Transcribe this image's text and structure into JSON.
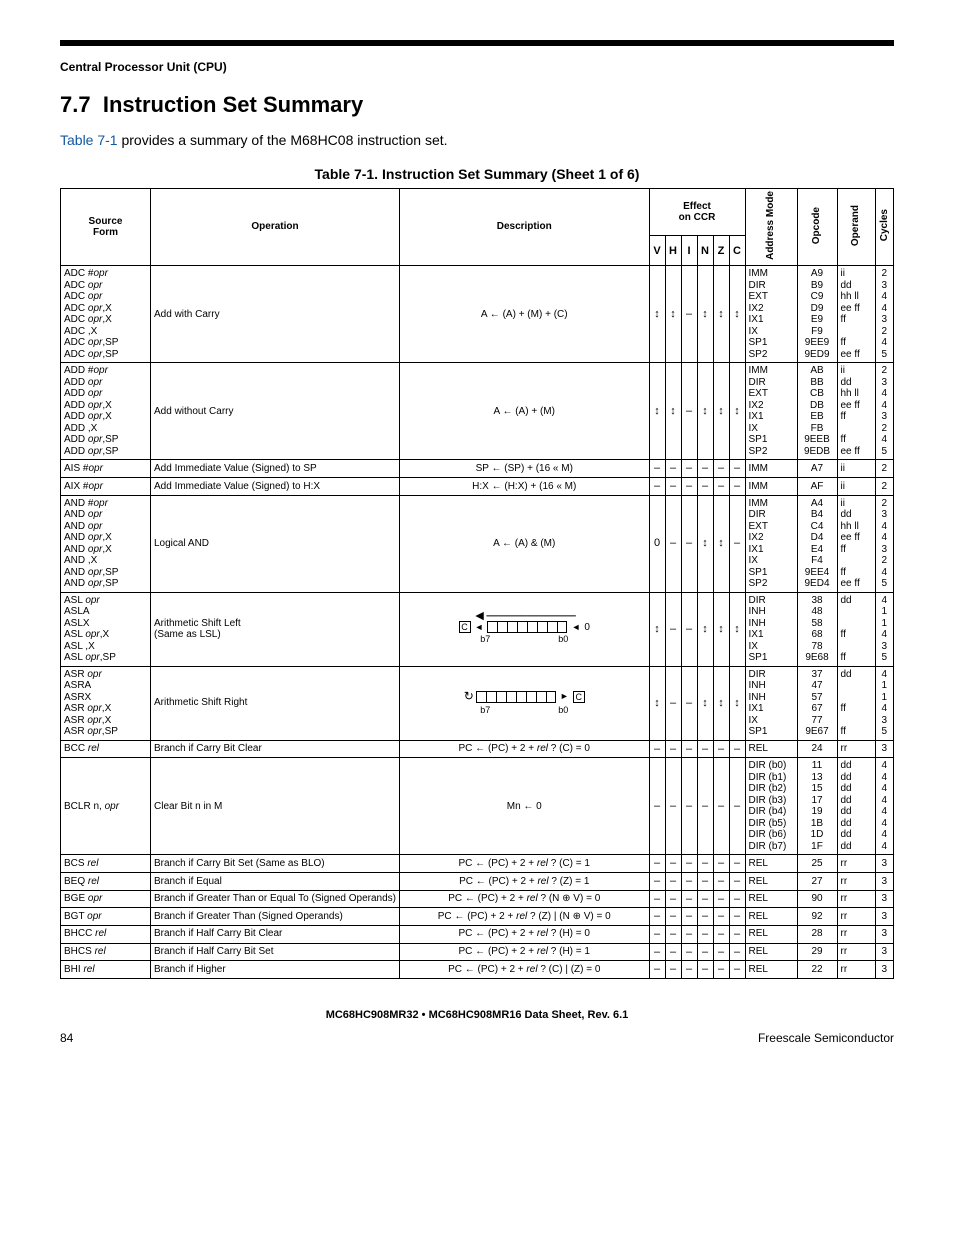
{
  "running_head": "Central Processor Unit (CPU)",
  "section_number": "7.7",
  "section_title": "Instruction Set Summary",
  "intro_link": "Table 7-1",
  "intro_rest": " provides a summary of the M68HC08 instruction set.",
  "table_caption": "Table 7-1. Instruction Set Summary (Sheet 1 of 6)",
  "headers": {
    "source_form": "Source\nForm",
    "operation": "Operation",
    "description": "Description",
    "effect": "Effect\non CCR",
    "addr_mode": "Address\nMode",
    "opcode": "Opcode",
    "operand": "Operand",
    "cycles": "Cycles",
    "ccr_cols": [
      "V",
      "H",
      "I",
      "N",
      "Z",
      "C"
    ]
  },
  "rows": [
    {
      "source": "ADC #opr\nADC opr\nADC opr\nADC opr,X\nADC opr,X\nADC ,X\nADC opr,SP\nADC opr,SP",
      "operation": "Add with Carry",
      "description": "A ← (A) + (M) + (C)",
      "ccr": [
        "↕",
        "↕",
        "–",
        "↕",
        "↕",
        "↕"
      ],
      "addr": "IMM\nDIR\nEXT\nIX2\nIX1\nIX\nSP1\nSP2",
      "opcode": "A9\nB9\nC9\nD9\nE9\nF9\n9EE9\n9ED9",
      "operand": "ii\ndd\nhh ll\nee ff\nff\n\nff\nee ff",
      "cycles": "2\n3\n4\n4\n3\n2\n4\n5"
    },
    {
      "source": "ADD #opr\nADD opr\nADD opr\nADD opr,X\nADD opr,X\nADD ,X\nADD opr,SP\nADD opr,SP",
      "operation": "Add without Carry",
      "description": "A ← (A) + (M)",
      "ccr": [
        "↕",
        "↕",
        "–",
        "↕",
        "↕",
        "↕"
      ],
      "addr": "IMM\nDIR\nEXT\nIX2\nIX1\nIX\nSP1\nSP2",
      "opcode": "AB\nBB\nCB\nDB\nEB\nFB\n9EEB\n9EDB",
      "operand": "ii\ndd\nhh ll\nee ff\nff\n\nff\nee ff",
      "cycles": "2\n3\n4\n4\n3\n2\n4\n5"
    },
    {
      "source": "AIS #opr",
      "source_italic_last": true,
      "operation": "Add Immediate Value (Signed) to SP",
      "description": "SP ← (SP) + (16 « M)",
      "ccr": [
        "–",
        "–",
        "–",
        "–",
        "–",
        "–"
      ],
      "addr": "IMM",
      "opcode": "A7",
      "operand": "ii",
      "cycles": "2"
    },
    {
      "source": "AIX #opr",
      "operation": "Add Immediate Value (Signed) to H:X",
      "description": "H:X ← (H:X) + (16 « M)",
      "ccr": [
        "–",
        "–",
        "–",
        "–",
        "–",
        "–"
      ],
      "addr": "IMM",
      "opcode": "AF",
      "operand": "ii",
      "cycles": "2"
    },
    {
      "source": "AND #opr\nAND opr\nAND opr\nAND opr,X\nAND opr,X\nAND ,X\nAND opr,SP\nAND opr,SP",
      "operation": "Logical AND",
      "description": "A ← (A) & (M)",
      "ccr": [
        "0",
        "–",
        "–",
        "↕",
        "↕",
        "–"
      ],
      "addr": "IMM\nDIR\nEXT\nIX2\nIX1\nIX\nSP1\nSP2",
      "opcode": "A4\nB4\nC4\nD4\nE4\nF4\n9EE4\n9ED4",
      "operand": "ii\ndd\nhh ll\nee ff\nff\n\nff\nee ff",
      "cycles": "2\n3\n4\n4\n3\n2\n4\n5"
    },
    {
      "source": "ASL opr\nASLA\nASLX\nASL opr,X\nASL ,X\nASL opr,SP",
      "operation": "Arithmetic Shift Left\n(Same as LSL)",
      "description_diagram": "asl",
      "ccr": [
        "↕",
        "–",
        "–",
        "↕",
        "↕",
        "↕"
      ],
      "addr": "DIR\nINH\nINH\nIX1\nIX\nSP1",
      "opcode": "38\n48\n58\n68\n78\n9E68",
      "operand": "dd\n\n\nff\n\nff",
      "cycles": "4\n1\n1\n4\n3\n5"
    },
    {
      "source": "ASR opr\nASRA\nASRX\nASR opr,X\nASR opr,X\nASR opr,SP",
      "operation": "Arithmetic Shift Right",
      "description_diagram": "asr",
      "ccr": [
        "↕",
        "–",
        "–",
        "↕",
        "↕",
        "↕"
      ],
      "addr": "DIR\nINH\nINH\nIX1\nIX\nSP1",
      "opcode": "37\n47\n57\n67\n77\n9E67",
      "operand": "dd\n\n\nff\n\nff",
      "cycles": "4\n1\n1\n4\n3\n5"
    },
    {
      "source": "BCC rel",
      "operation": "Branch if Carry Bit Clear",
      "description": "PC ← (PC) + 2 + rel ? (C) = 0",
      "ccr": [
        "–",
        "–",
        "–",
        "–",
        "–",
        "–"
      ],
      "addr": "REL",
      "opcode": "24",
      "operand": "rr",
      "cycles": "3"
    },
    {
      "source": "BCLR n, opr",
      "operation": "Clear Bit n in M",
      "description": "Mn ← 0",
      "ccr": [
        "–",
        "–",
        "–",
        "–",
        "–",
        "–"
      ],
      "addr": "DIR (b0)\nDIR (b1)\nDIR (b2)\nDIR (b3)\nDIR (b4)\nDIR (b5)\nDIR (b6)\nDIR (b7)",
      "opcode": "11\n13\n15\n17\n19\n1B\n1D\n1F",
      "operand": "dd\ndd\ndd\ndd\ndd\ndd\ndd\ndd",
      "cycles": "4\n4\n4\n4\n4\n4\n4\n4"
    },
    {
      "source": "BCS rel",
      "operation": "Branch if Carry Bit Set (Same as BLO)",
      "description": "PC ← (PC) + 2 + rel ? (C) = 1",
      "ccr": [
        "–",
        "–",
        "–",
        "–",
        "–",
        "–"
      ],
      "addr": "REL",
      "opcode": "25",
      "operand": "rr",
      "cycles": "3"
    },
    {
      "source": "BEQ rel",
      "operation": "Branch if Equal",
      "description": "PC ← (PC) + 2 + rel ? (Z) = 1",
      "ccr": [
        "–",
        "–",
        "–",
        "–",
        "–",
        "–"
      ],
      "addr": "REL",
      "opcode": "27",
      "operand": "rr",
      "cycles": "3"
    },
    {
      "source": "BGE opr",
      "operation": "Branch if Greater Than or Equal To (Signed Operands)",
      "description": "PC ← (PC) + 2 + rel ? (N ⊕ V) = 0",
      "ccr": [
        "–",
        "–",
        "–",
        "–",
        "–",
        "–"
      ],
      "addr": "REL",
      "opcode": "90",
      "operand": "rr",
      "cycles": "3"
    },
    {
      "source": "BGT opr",
      "operation": "Branch if Greater Than (Signed Operands)",
      "description": "PC ← (PC) + 2 + rel ? (Z) | (N ⊕ V) = 0",
      "ccr": [
        "–",
        "–",
        "–",
        "–",
        "–",
        "–"
      ],
      "addr": "REL",
      "opcode": "92",
      "operand": "rr",
      "cycles": "3"
    },
    {
      "source": "BHCC rel",
      "operation": "Branch if Half Carry Bit Clear",
      "description": "PC ← (PC) + 2 + rel ? (H) = 0",
      "ccr": [
        "–",
        "–",
        "–",
        "–",
        "–",
        "–"
      ],
      "addr": "REL",
      "opcode": "28",
      "operand": "rr",
      "cycles": "3"
    },
    {
      "source": "BHCS rel",
      "operation": "Branch if Half Carry Bit Set",
      "description": "PC ← (PC) + 2 + rel ? (H) = 1",
      "ccr": [
        "–",
        "–",
        "–",
        "–",
        "–",
        "–"
      ],
      "addr": "REL",
      "opcode": "29",
      "operand": "rr",
      "cycles": "3"
    },
    {
      "source": "BHI rel",
      "operation": "Branch if Higher",
      "description": "PC ← (PC) + 2 + rel ? (C) | (Z) = 0",
      "ccr": [
        "–",
        "–",
        "–",
        "–",
        "–",
        "–"
      ],
      "addr": "REL",
      "opcode": "22",
      "operand": "rr",
      "cycles": "3"
    }
  ],
  "diagram_labels": {
    "b7": "b7",
    "b0": "b0",
    "c": "C",
    "zero": "0"
  },
  "footer_doc": "MC68HC908MR32 • MC68HC908MR16 Data Sheet, Rev. 6.1",
  "page_number": "84",
  "footer_right": "Freescale Semiconductor"
}
